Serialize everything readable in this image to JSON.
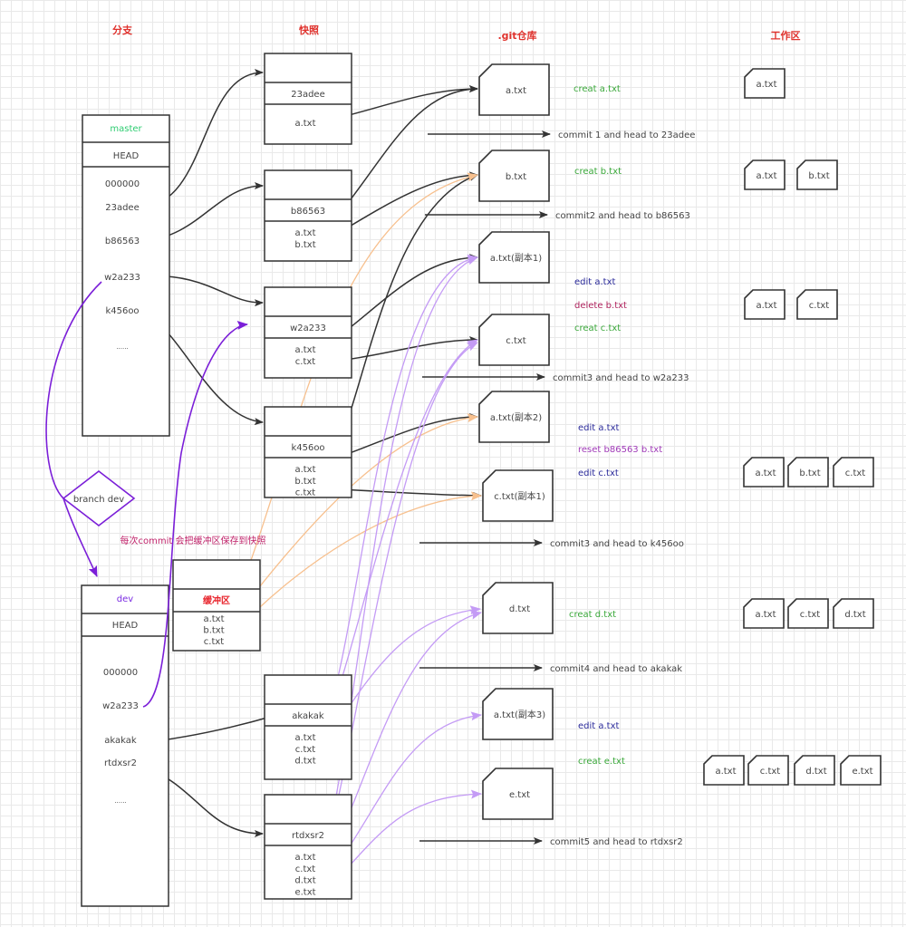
{
  "headers": {
    "branches": "分支",
    "snapshots": "快照",
    "repo": ".git仓库",
    "workspace": "工作区"
  },
  "colors": {
    "header": "#e0322d",
    "master": "#2ecc71",
    "dev": "#7a2be2",
    "stage_title": "#e8222a",
    "note": "#c0226a",
    "create": "#3aa83a",
    "edit": "#2a2a9a",
    "delete": "#b0245e",
    "reset": "#a03ab8",
    "line": "#333333",
    "purple_arrow": "#7b1fd8",
    "light_purple": "#c49bf5",
    "orange": "#f7c08e",
    "text": "#444444"
  },
  "master": {
    "name": "master",
    "head": "HEAD",
    "commits": [
      "000000",
      "23adee",
      "b86563",
      "w2a233",
      "k456oo",
      "......"
    ]
  },
  "dev": {
    "name": "dev",
    "head": "HEAD",
    "commits": [
      "000000",
      "w2a233",
      "akakak",
      "rtdxsr2",
      "......"
    ]
  },
  "branch_node": "branch dev",
  "stage_note": "每次commit 会把缓冲区保存到快照",
  "stage": {
    "title": "缓冲区",
    "files": [
      "a.txt",
      "b.txt",
      "c.txt"
    ]
  },
  "snapshots": [
    {
      "id": "23adee",
      "files": [
        "a.txt"
      ]
    },
    {
      "id": "b86563",
      "files": [
        "a.txt",
        "b.txt"
      ]
    },
    {
      "id": "w2a233",
      "files": [
        "a.txt",
        "c.txt"
      ]
    },
    {
      "id": "k456oo",
      "files": [
        "a.txt",
        "b.txt",
        "c.txt"
      ]
    },
    {
      "id": "akakak",
      "files": [
        "a.txt",
        "c.txt",
        "d.txt"
      ]
    },
    {
      "id": "rtdxsr2",
      "files": [
        "a.txt",
        "c.txt",
        "d.txt",
        "e.txt"
      ]
    }
  ],
  "repo_objects": [
    "a.txt",
    "b.txt",
    "a.txt(副本1)",
    "c.txt",
    "a.txt(副本2)",
    "c.txt(副本1)",
    "d.txt",
    "a.txt(副本3)",
    "e.txt"
  ],
  "commits": [
    "commit 1 and head to 23adee",
    "commit2 and head to b86563",
    "commit3 and head to w2a233",
    "commit3 and head to k456oo",
    "commit4 and head to akakak",
    "commit5 and head to rtdxsr2"
  ],
  "operations": [
    {
      "text": "creat a.txt",
      "kind": "create"
    },
    {
      "text": "creat b.txt",
      "kind": "create"
    },
    {
      "text": "edit a.txt",
      "kind": "edit"
    },
    {
      "text": "delete b.txt",
      "kind": "delete"
    },
    {
      "text": "creat c.txt",
      "kind": "create"
    },
    {
      "text": "edit a.txt",
      "kind": "edit"
    },
    {
      "text": "reset    b86563   b.txt",
      "kind": "reset"
    },
    {
      "text": "edit c.txt",
      "kind": "edit"
    },
    {
      "text": "creat d.txt",
      "kind": "create"
    },
    {
      "text": "edit a.txt",
      "kind": "edit"
    },
    {
      "text": "creat e.txt",
      "kind": "create"
    }
  ],
  "workspace": [
    [
      "a.txt"
    ],
    [
      "a.txt",
      "b.txt"
    ],
    [
      "a.txt",
      "c.txt"
    ],
    [
      "a.txt",
      "b.txt",
      "c.txt"
    ],
    [
      "a.txt",
      "c.txt",
      "d.txt"
    ],
    [
      "a.txt",
      "c.txt",
      "d.txt",
      "e.txt"
    ]
  ]
}
